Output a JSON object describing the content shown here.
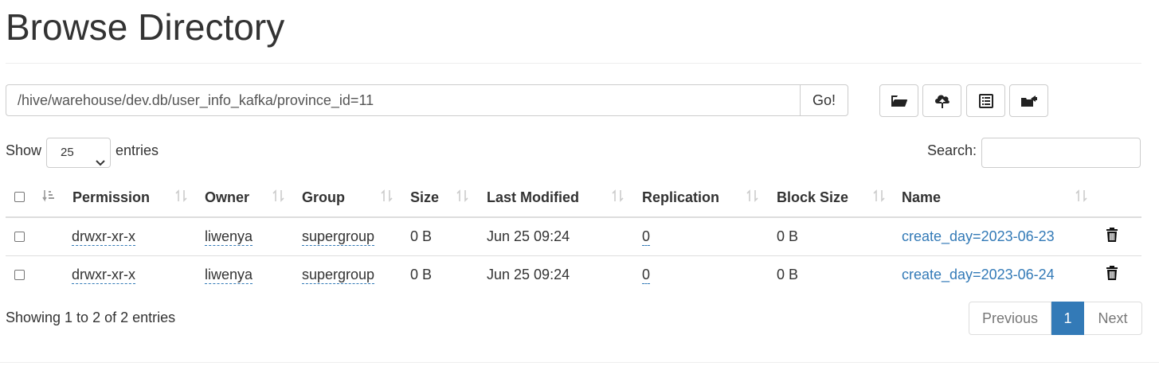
{
  "page": {
    "title": "Browse Directory"
  },
  "path": {
    "value": "/hive/warehouse/dev.db/user_info_kafka/province_id=11",
    "go_label": "Go!"
  },
  "toolbar": {
    "buttons": [
      {
        "icon": "folder-open-icon"
      },
      {
        "icon": "cloud-upload-icon"
      },
      {
        "icon": "list-alt-icon"
      },
      {
        "icon": "folder-move-icon"
      }
    ]
  },
  "length": {
    "show_label": "Show",
    "value": "25",
    "entries_label": "entries"
  },
  "search": {
    "label": "Search:",
    "value": ""
  },
  "table": {
    "headers": [
      "Permission",
      "Owner",
      "Group",
      "Size",
      "Last Modified",
      "Replication",
      "Block Size",
      "Name"
    ],
    "rows": [
      {
        "permission": "drwxr-xr-x",
        "owner": "liwenya",
        "group": "supergroup",
        "size": "0 B",
        "last_modified": "Jun 25 09:24",
        "replication": "0",
        "block_size": "0 B",
        "name": "create_day=2023-06-23"
      },
      {
        "permission": "drwxr-xr-x",
        "owner": "liwenya",
        "group": "supergroup",
        "size": "0 B",
        "last_modified": "Jun 25 09:24",
        "replication": "0",
        "block_size": "0 B",
        "name": "create_day=2023-06-24"
      }
    ]
  },
  "info": {
    "text": "Showing 1 to 2 of 2 entries"
  },
  "pagination": {
    "previous": "Previous",
    "current": "1",
    "next": "Next"
  },
  "colors": {
    "accent": "#337ab7",
    "border": "#dddddd"
  }
}
